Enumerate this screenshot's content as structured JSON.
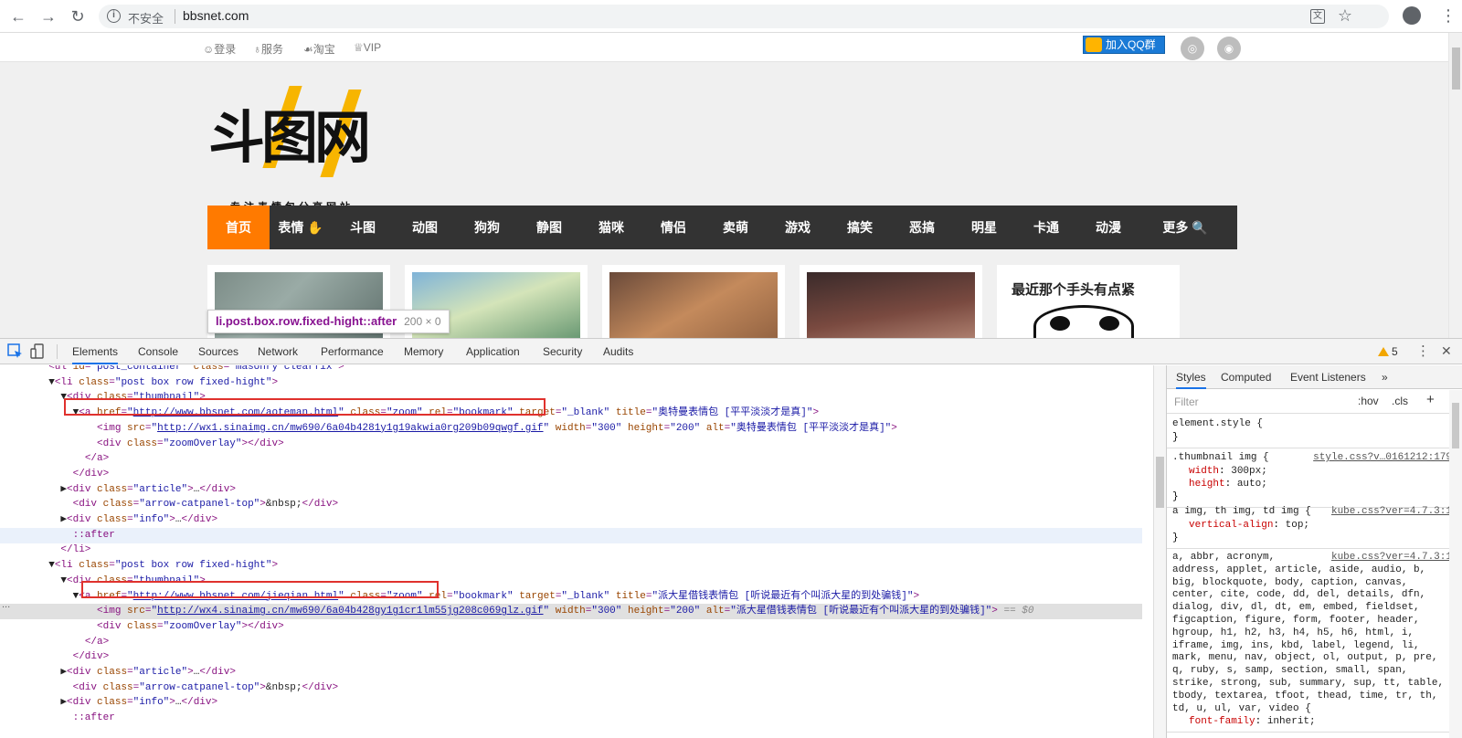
{
  "browser": {
    "back_glyph": "←",
    "forward_glyph": "→",
    "reload_glyph": "↻",
    "info_glyph": "i",
    "security_label": "不安全",
    "url": "bbsnet.com",
    "translate_glyph": "文",
    "star_glyph": "☆",
    "menu_glyph": "⋮"
  },
  "site": {
    "top_links": [
      "☺登录",
      "♁服务",
      "☙淘宝",
      "♕VIP"
    ],
    "qq_button": "加入QQ群",
    "social_icons": [
      "weibo-icon",
      "rss-icon"
    ],
    "social_glyphs": [
      "◎",
      "◉"
    ],
    "logo_text": "斗图网",
    "logo_subtitle": "专注表情包分享网站",
    "nav": [
      "首页",
      "表情 ✋",
      "斗图",
      "动图",
      "狗狗",
      "静图",
      "猫咪",
      "情侣",
      "卖萌",
      "游戏",
      "搞笑",
      "恶搞",
      "明星",
      "卡通",
      "动漫",
      "更多 🔍"
    ],
    "nav_active_index": 0,
    "card5_title": "最近那个手头有点紧",
    "tooltip": {
      "selector": "li.post.box.row.fixed-hight::after",
      "size": "200 × 0"
    }
  },
  "devtools": {
    "tabs": [
      "Elements",
      "Console",
      "Sources",
      "Network",
      "Performance",
      "Memory",
      "Application",
      "Security",
      "Audits"
    ],
    "active_tab": "Elements",
    "warnings": "5",
    "more_glyph": "⋮",
    "close_glyph": "✕",
    "ellipsis_marker": "...",
    "side_tabs": [
      "Styles",
      "Computed",
      "Event Listeners",
      "»"
    ],
    "filter_placeholder": "Filter",
    "hov_label": ":hov",
    "cls_label": ".cls",
    "plus_label": "+",
    "rules": [
      {
        "selector": "element.style {",
        "source": "",
        "props": [],
        "close": "}"
      },
      {
        "selector": ".thumbnail img {",
        "source": "style.css?v…0161212:179",
        "props": [
          [
            "width",
            "300px;"
          ],
          [
            "height",
            "auto;"
          ]
        ],
        "close": "}"
      },
      {
        "selector": "a img, th img, td img {",
        "source": "kube.css?ver=4.7.3:1",
        "props": [
          [
            "vertical-align",
            "top;"
          ]
        ],
        "close": "}"
      },
      {
        "selector": "a, abbr, acronym,\naddress, applet, article, aside, audio, b,\nbig, blockquote, body, caption, canvas,\ncenter, cite, code, dd, del, details, dfn,\ndialog, div, dl, dt, em, embed, fieldset,\nfigcaption, figure, form, footer, header,\nhgroup, h1, h2, h3, h4, h5, h6, html, i,\niframe, img, ins, kbd, label, legend, li,\nmark, menu, nav, object, ol, output, p, pre,\nq, ruby, s, samp, section, small, span,\nstrike, strong, sub, summary, sup, tt, table,\ntbody, textarea, tfoot, thead, time, tr, th,\ntd, u, ul, var, video {",
        "source": "kube.css?ver=4.7.3:1",
        "props": [
          [
            "font-family",
            "inherit;"
          ]
        ],
        "close": ""
      }
    ],
    "dom_lines": [
      {
        "segs": [
          [
            "tx",
            "  "
          ],
          [
            "tg",
            "<ul "
          ],
          [
            "at",
            "id"
          ],
          [
            "tg",
            "="
          ],
          [
            "av",
            "\"post_container\""
          ],
          [
            "tg",
            " "
          ],
          [
            "at",
            "class"
          ],
          [
            "tg",
            "="
          ],
          [
            "av",
            "\"masonry clearfix\""
          ],
          [
            "tg",
            ">"
          ]
        ]
      },
      {
        "segs": [
          [
            "tx",
            "  ▼"
          ],
          [
            "tg",
            "<li "
          ],
          [
            "at",
            "class"
          ],
          [
            "tg",
            "="
          ],
          [
            "av",
            "\"post box row fixed-hight\""
          ],
          [
            "tg",
            ">"
          ]
        ]
      },
      {
        "segs": [
          [
            "tx",
            "    ▼"
          ],
          [
            "tg",
            "<div "
          ],
          [
            "at",
            "class"
          ],
          [
            "tg",
            "="
          ],
          [
            "av",
            "\"thumbnail\""
          ],
          [
            "tg",
            ">"
          ]
        ]
      },
      {
        "segs": [
          [
            "tx",
            "      ▼"
          ],
          [
            "tg",
            "<a "
          ],
          [
            "at",
            "href"
          ],
          [
            "tg",
            "="
          ],
          [
            "av",
            "\""
          ],
          [
            "ln",
            "http://www.bbsnet.com/aoteman.html"
          ],
          [
            "av",
            "\""
          ],
          [
            "tg",
            " "
          ],
          [
            "at",
            "class"
          ],
          [
            "tg",
            "="
          ],
          [
            "av",
            "\"zoom\""
          ],
          [
            "tg",
            " "
          ],
          [
            "at",
            "rel"
          ],
          [
            "tg",
            "="
          ],
          [
            "av",
            "\"bookmark\""
          ],
          [
            "tg",
            " "
          ],
          [
            "at",
            "target"
          ],
          [
            "tg",
            "="
          ],
          [
            "av",
            "\"_blank\""
          ],
          [
            "tg",
            " "
          ],
          [
            "at",
            "title"
          ],
          [
            "tg",
            "="
          ],
          [
            "av",
            "\"奥特曼表情包 [平平淡淡才是真]\""
          ],
          [
            "tg",
            ">"
          ]
        ]
      },
      {
        "segs": [
          [
            "tx",
            "          "
          ],
          [
            "tg",
            "<img "
          ],
          [
            "at",
            "src"
          ],
          [
            "tg",
            "="
          ],
          [
            "av",
            "\""
          ],
          [
            "ln",
            "http://wx1.sinaimg.cn/mw690/6a04b4281y1g19akwia0rg209b09qwgf.gif"
          ],
          [
            "av",
            "\""
          ],
          [
            "tg",
            " "
          ],
          [
            "at",
            "width"
          ],
          [
            "tg",
            "="
          ],
          [
            "av",
            "\"300\""
          ],
          [
            "tg",
            " "
          ],
          [
            "at",
            "height"
          ],
          [
            "tg",
            "="
          ],
          [
            "av",
            "\"200\""
          ],
          [
            "tg",
            " "
          ],
          [
            "at",
            "alt"
          ],
          [
            "tg",
            "="
          ],
          [
            "av",
            "\"奥特曼表情包 [平平淡淡才是真]\""
          ],
          [
            "tg",
            ">"
          ]
        ]
      },
      {
        "segs": [
          [
            "tx",
            "          "
          ],
          [
            "tg",
            "<div "
          ],
          [
            "at",
            "class"
          ],
          [
            "tg",
            "="
          ],
          [
            "av",
            "\"zoomOverlay\""
          ],
          [
            "tg",
            "></div>"
          ]
        ]
      },
      {
        "segs": [
          [
            "tx",
            "        "
          ],
          [
            "tg",
            "</a>"
          ]
        ]
      },
      {
        "segs": [
          [
            "tx",
            "      "
          ],
          [
            "tg",
            "</div>"
          ]
        ]
      },
      {
        "segs": [
          [
            "tx",
            "    ▶"
          ],
          [
            "tg",
            "<div "
          ],
          [
            "at",
            "class"
          ],
          [
            "tg",
            "="
          ],
          [
            "av",
            "\"article\""
          ],
          [
            "tg",
            ">"
          ],
          [
            "tx",
            "…"
          ],
          [
            "tg",
            "</div>"
          ]
        ]
      },
      {
        "segs": [
          [
            "tx",
            "      "
          ],
          [
            "tg",
            "<div "
          ],
          [
            "at",
            "class"
          ],
          [
            "tg",
            "="
          ],
          [
            "av",
            "\"arrow-catpanel-top\""
          ],
          [
            "tg",
            ">"
          ],
          [
            "tx",
            "&nbsp;"
          ],
          [
            "tg",
            "</div>"
          ]
        ]
      },
      {
        "segs": [
          [
            "tx",
            "    ▶"
          ],
          [
            "tg",
            "<div "
          ],
          [
            "at",
            "class"
          ],
          [
            "tg",
            "="
          ],
          [
            "av",
            "\"info\""
          ],
          [
            "tg",
            ">"
          ],
          [
            "tx",
            "…"
          ],
          [
            "tg",
            "</div>"
          ]
        ]
      },
      {
        "segs": [
          [
            "tx",
            "      "
          ],
          [
            "ps",
            "::after"
          ]
        ],
        "hover": true
      },
      {
        "segs": [
          [
            "tx",
            "    "
          ],
          [
            "tg",
            "</li>"
          ]
        ]
      },
      {
        "segs": [
          [
            "tx",
            "  ▼"
          ],
          [
            "tg",
            "<li "
          ],
          [
            "at",
            "class"
          ],
          [
            "tg",
            "="
          ],
          [
            "av",
            "\"post box row fixed-hight\""
          ],
          [
            "tg",
            ">"
          ]
        ]
      },
      {
        "segs": [
          [
            "tx",
            "    ▼"
          ],
          [
            "tg",
            "<div "
          ],
          [
            "at",
            "class"
          ],
          [
            "tg",
            "="
          ],
          [
            "av",
            "\"thumbnail\""
          ],
          [
            "tg",
            ">"
          ]
        ]
      },
      {
        "segs": [
          [
            "tx",
            "      ▼"
          ],
          [
            "tg",
            "<a "
          ],
          [
            "at",
            "href"
          ],
          [
            "tg",
            "="
          ],
          [
            "av",
            "\""
          ],
          [
            "ln",
            "http://www.bbsnet.com/jieqian.html"
          ],
          [
            "av",
            "\""
          ],
          [
            "tg",
            " "
          ],
          [
            "at",
            "class"
          ],
          [
            "tg",
            "="
          ],
          [
            "av",
            "\"zoom\""
          ],
          [
            "tg",
            " "
          ],
          [
            "at",
            "rel"
          ],
          [
            "tg",
            "="
          ],
          [
            "av",
            "\"bookmark\""
          ],
          [
            "tg",
            " "
          ],
          [
            "at",
            "target"
          ],
          [
            "tg",
            "="
          ],
          [
            "av",
            "\"_blank\""
          ],
          [
            "tg",
            " "
          ],
          [
            "at",
            "title"
          ],
          [
            "tg",
            "="
          ],
          [
            "av",
            "\"派大星借钱表情包 [听说最近有个叫派大星的到处骗钱]\""
          ],
          [
            "tg",
            ">"
          ]
        ]
      },
      {
        "segs": [
          [
            "tx",
            "          "
          ],
          [
            "tg",
            "<img "
          ],
          [
            "at",
            "src"
          ],
          [
            "tg",
            "="
          ],
          [
            "av",
            "\""
          ],
          [
            "ln",
            "http://wx4.sinaimg.cn/mw690/6a04b428gy1g1cr1lm55jg208c069glz.gif"
          ],
          [
            "av",
            "\""
          ],
          [
            "tg",
            " "
          ],
          [
            "at",
            "width"
          ],
          [
            "tg",
            "="
          ],
          [
            "av",
            "\"300\""
          ],
          [
            "tg",
            " "
          ],
          [
            "at",
            "height"
          ],
          [
            "tg",
            "="
          ],
          [
            "av",
            "\"200\""
          ],
          [
            "tg",
            " "
          ],
          [
            "at",
            "alt"
          ],
          [
            "tg",
            "="
          ],
          [
            "av",
            "\"派大星借钱表情包 [听说最近有个叫派大星的到处骗钱]\""
          ],
          [
            "tg",
            ">"
          ],
          [
            "dm",
            " == $0"
          ]
        ],
        "selected": true
      },
      {
        "segs": [
          [
            "tx",
            "          "
          ],
          [
            "tg",
            "<div "
          ],
          [
            "at",
            "class"
          ],
          [
            "tg",
            "="
          ],
          [
            "av",
            "\"zoomOverlay\""
          ],
          [
            "tg",
            "></div>"
          ]
        ]
      },
      {
        "segs": [
          [
            "tx",
            "        "
          ],
          [
            "tg",
            "</a>"
          ]
        ]
      },
      {
        "segs": [
          [
            "tx",
            "      "
          ],
          [
            "tg",
            "</div>"
          ]
        ]
      },
      {
        "segs": [
          [
            "tx",
            "    ▶"
          ],
          [
            "tg",
            "<div "
          ],
          [
            "at",
            "class"
          ],
          [
            "tg",
            "="
          ],
          [
            "av",
            "\"article\""
          ],
          [
            "tg",
            ">"
          ],
          [
            "tx",
            "…"
          ],
          [
            "tg",
            "</div>"
          ]
        ]
      },
      {
        "segs": [
          [
            "tx",
            "      "
          ],
          [
            "tg",
            "<div "
          ],
          [
            "at",
            "class"
          ],
          [
            "tg",
            "="
          ],
          [
            "av",
            "\"arrow-catpanel-top\""
          ],
          [
            "tg",
            ">"
          ],
          [
            "tx",
            "&nbsp;"
          ],
          [
            "tg",
            "</div>"
          ]
        ]
      },
      {
        "segs": [
          [
            "tx",
            "    ▶"
          ],
          [
            "tg",
            "<div "
          ],
          [
            "at",
            "class"
          ],
          [
            "tg",
            "="
          ],
          [
            "av",
            "\"info\""
          ],
          [
            "tg",
            ">"
          ],
          [
            "tx",
            "…"
          ],
          [
            "tg",
            "</div>"
          ]
        ]
      },
      {
        "segs": [
          [
            "tx",
            "      "
          ],
          [
            "ps",
            "::after"
          ]
        ]
      }
    ]
  },
  "colors": {
    "accent": "#ff7a00",
    "nav_bg": "#333333",
    "highlight_box": "#e0312d"
  }
}
